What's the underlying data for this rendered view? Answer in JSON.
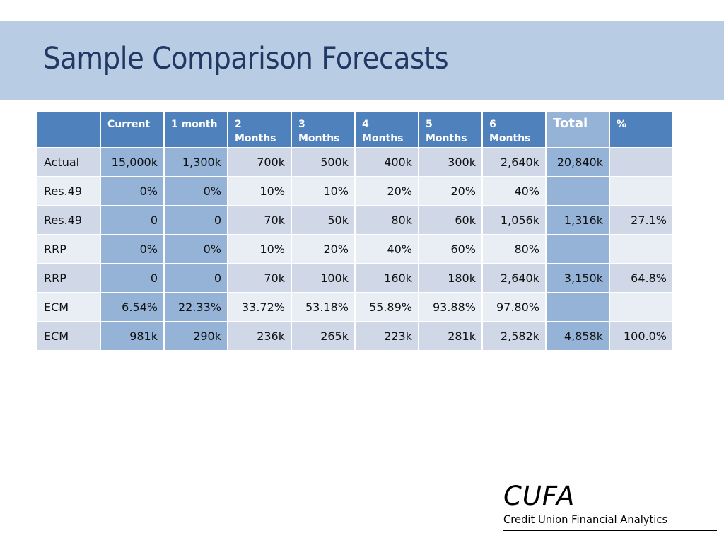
{
  "slide": {
    "title": "Sample Comparison Forecasts"
  },
  "table": {
    "headers": [
      {
        "line1": "",
        "line2": ""
      },
      {
        "line1": "Current",
        "line2": ""
      },
      {
        "line1": "1 month",
        "line2": ""
      },
      {
        "line1": "2",
        "line2": "Months"
      },
      {
        "line1": "3",
        "line2": "Months"
      },
      {
        "line1": "4",
        "line2": "Months"
      },
      {
        "line1": "5",
        "line2": "Months"
      },
      {
        "line1": "6",
        "line2": "Months"
      },
      {
        "line1": "Total",
        "line2": ""
      },
      {
        "line1": "%",
        "line2": ""
      }
    ],
    "rows": [
      [
        "Actual",
        "15,000k",
        "1,300k",
        "700k",
        "500k",
        "400k",
        "300k",
        "2,640k",
        "20,840k",
        ""
      ],
      [
        "Res.49",
        "0%",
        "0%",
        "10%",
        "10%",
        "20%",
        "20%",
        "40%",
        "",
        ""
      ],
      [
        "Res.49",
        "0",
        "0",
        "70k",
        "50k",
        "80k",
        "60k",
        "1,056k",
        "1,316k",
        "27.1%"
      ],
      [
        "RRP",
        "0%",
        "0%",
        "10%",
        "20%",
        "40%",
        "60%",
        "80%",
        "",
        ""
      ],
      [
        "RRP",
        "0",
        "0",
        "70k",
        "100k",
        "160k",
        "180k",
        "2,640k",
        "3,150k",
        "64.8%"
      ],
      [
        "ECM",
        "6.54%",
        "22.33%",
        "33.72%",
        "53.18%",
        "55.89%",
        "93.88%",
        "97.80%",
        "",
        ""
      ],
      [
        "ECM",
        "981k",
        "290k",
        "236k",
        "265k",
        "223k",
        "281k",
        "2,582k",
        "4,858k",
        "100.0%"
      ]
    ]
  },
  "logo": {
    "name": "CUFA",
    "tagline": "Credit Union Financial Analytics"
  },
  "colors": {
    "title_band": "#b8cce4",
    "title_text": "#1f3864",
    "header": "#4f81bd",
    "highlight": "#95b3d7",
    "row_odd": "#d0d8e8",
    "row_even": "#e9edf4"
  }
}
